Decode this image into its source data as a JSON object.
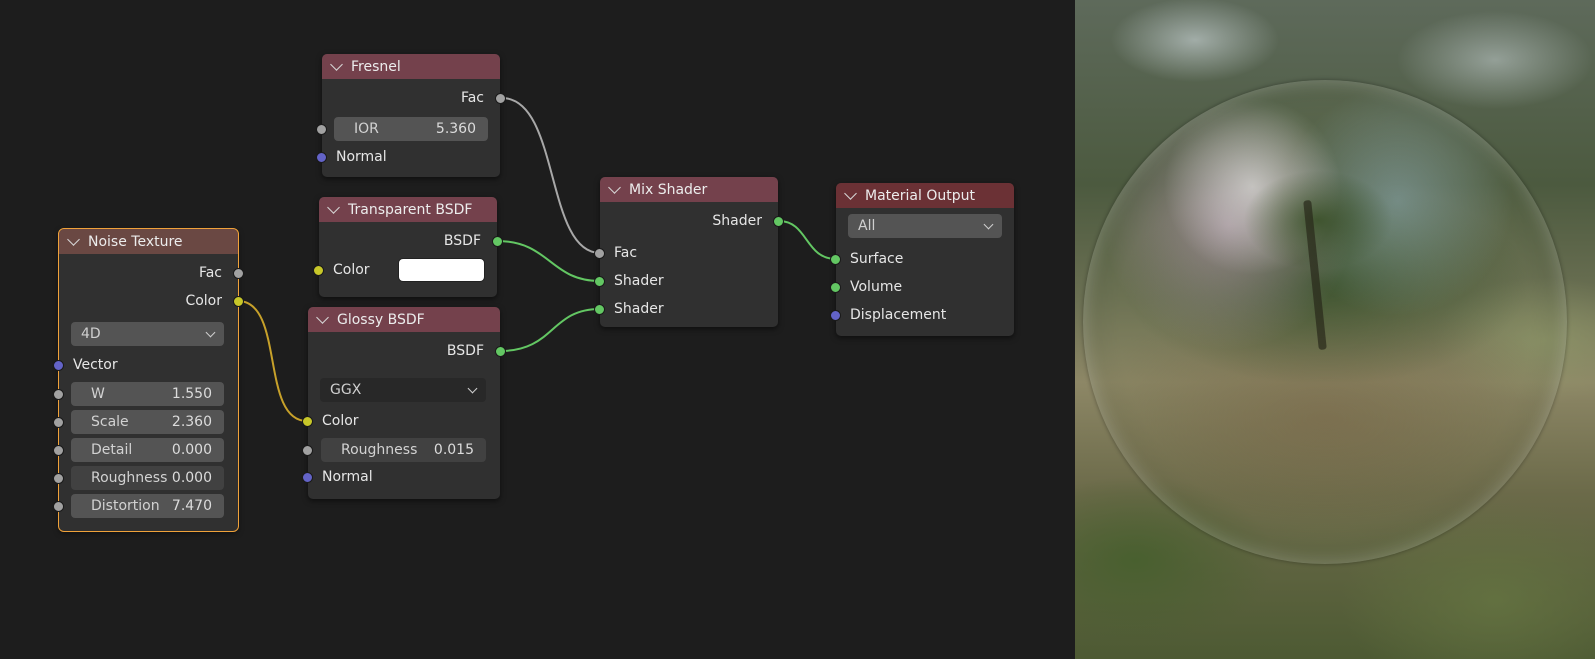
{
  "nodes": {
    "fresnel": {
      "title": "Fresnel",
      "outputs": [
        "Fac"
      ],
      "ior_label": "IOR",
      "ior_value": "5.360",
      "inputs": [
        "Normal"
      ]
    },
    "transparent_bsdf": {
      "title": "Transparent BSDF",
      "outputs": [
        "BSDF"
      ],
      "color_label": "Color",
      "color_value": "#ffffff"
    },
    "glossy_bsdf": {
      "title": "Glossy BSDF",
      "outputs": [
        "BSDF"
      ],
      "distribution": "GGX",
      "color_label": "Color",
      "roughness_label": "Roughness",
      "roughness_value": "0.015",
      "normal_label": "Normal"
    },
    "noise_texture": {
      "title": "Noise Texture",
      "outputs": [
        "Fac",
        "Color"
      ],
      "dimensions": "4D",
      "vector_label": "Vector",
      "fields": [
        {
          "label": "W",
          "value": "1.550"
        },
        {
          "label": "Scale",
          "value": "2.360"
        },
        {
          "label": "Detail",
          "value": "0.000"
        },
        {
          "label": "Roughness",
          "value": "0.000"
        },
        {
          "label": "Distortion",
          "value": "7.470"
        }
      ]
    },
    "mix_shader": {
      "title": "Mix Shader",
      "outputs": [
        "Shader"
      ],
      "inputs": [
        "Fac",
        "Shader",
        "Shader"
      ]
    },
    "material_output": {
      "title": "Material Output",
      "target": "All",
      "inputs": [
        "Surface",
        "Volume",
        "Displacement"
      ]
    }
  },
  "colors": {
    "socket_float": "#a1a1a1",
    "socket_vector": "#6363c7",
    "socket_color": "#c7c729",
    "socket_shader": "#63c763",
    "selected_outline": "#f0a23a"
  }
}
